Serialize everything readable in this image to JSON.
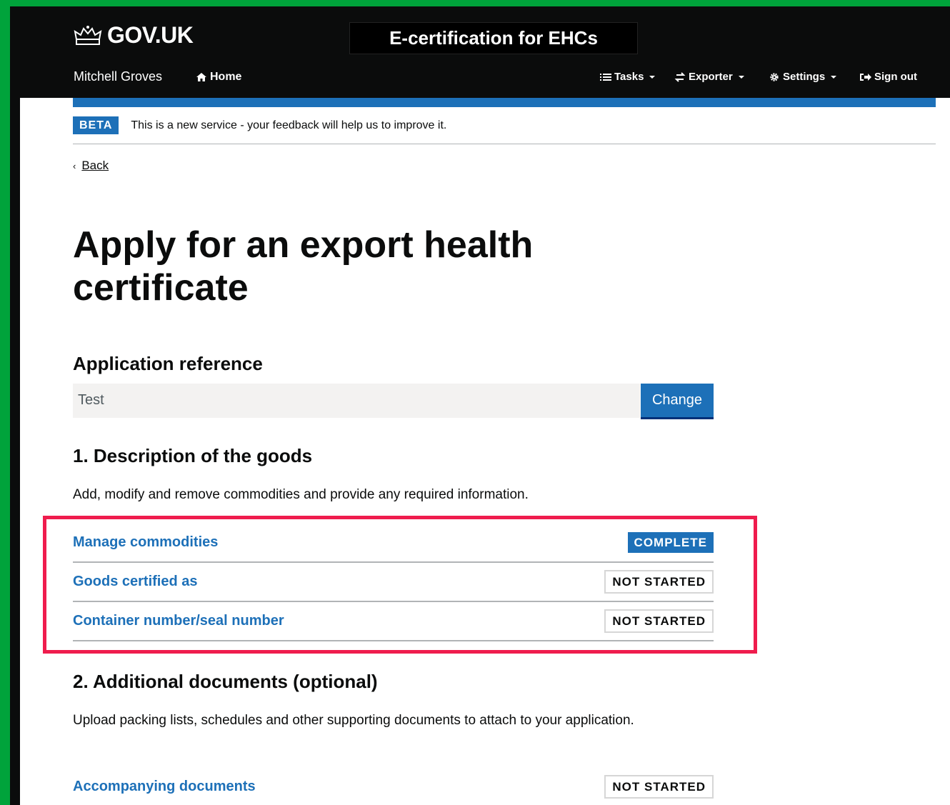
{
  "header": {
    "logo_text": "GOV.UK",
    "service_name": "E-certification for EHCs",
    "user_name": "Mitchell Groves",
    "nav": {
      "home": "Home",
      "tasks": "Tasks",
      "exporter": "Exporter",
      "settings": "Settings",
      "sign_out": "Sign out"
    }
  },
  "banner": {
    "tag": "BETA",
    "text": "This is a new service - your feedback will help us to improve it."
  },
  "back_link": "Back",
  "page_title": "Apply for an export health certificate",
  "application_reference": {
    "heading": "Application reference",
    "value": "Test",
    "change_label": "Change"
  },
  "section1": {
    "heading": "1. Description of the goods",
    "description": "Add, modify and remove commodities and provide any required information.",
    "tasks": [
      {
        "label": "Manage commodities",
        "status": "COMPLETE"
      },
      {
        "label": "Goods certified as",
        "status": "NOT STARTED"
      },
      {
        "label": "Container number/seal number",
        "status": "NOT STARTED"
      }
    ]
  },
  "section2": {
    "heading": "2. Additional documents (optional)",
    "description": "Upload packing lists, schedules and other supporting documents to attach to your application.",
    "tasks": [
      {
        "label": "Accompanying documents",
        "status": "NOT STARTED"
      }
    ]
  },
  "colors": {
    "accent_green": "#00a33b",
    "govuk_blue": "#1d70b8",
    "highlight_red": "#ef1c4d",
    "header_black": "#0b0c0c"
  }
}
